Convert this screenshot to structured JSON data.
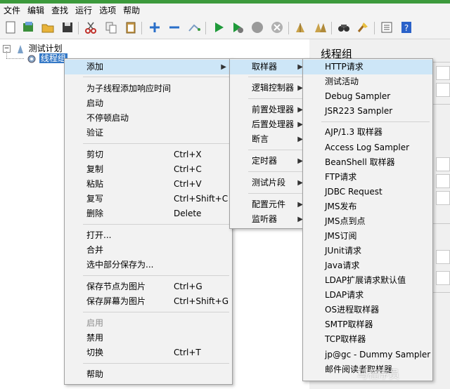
{
  "menubar": {
    "items": [
      "文件",
      "编辑",
      "查找",
      "运行",
      "选项",
      "帮助"
    ]
  },
  "toolbar": {
    "icons": [
      "new-icon",
      "templates-icon",
      "open-icon",
      "save-icon",
      "cut-icon",
      "copy-icon",
      "paste-icon",
      "expand-icon",
      "collapse-icon",
      "toggle-icon",
      "start-icon",
      "start-no-pause-icon",
      "stop-icon",
      "shutdown-icon",
      "clear-icon",
      "clear-all-icon",
      "search-icon",
      "reset-search-icon",
      "function-helper-icon",
      "help-icon"
    ]
  },
  "tree": {
    "root": "测试计划",
    "child": "线程组"
  },
  "right_panel": {
    "title": "线程组"
  },
  "context_menu": {
    "items": [
      {
        "label": "添加",
        "accel": "",
        "submenu": true
      },
      {
        "label": "为子线程添加响应时间",
        "accel": ""
      },
      {
        "label": "启动",
        "accel": ""
      },
      {
        "label": "不停顿启动",
        "accel": ""
      },
      {
        "label": "验证",
        "accel": ""
      },
      {
        "label": "剪切",
        "accel": "Ctrl+X"
      },
      {
        "label": "复制",
        "accel": "Ctrl+C"
      },
      {
        "label": "粘贴",
        "accel": "Ctrl+V"
      },
      {
        "label": "复写",
        "accel": "Ctrl+Shift+C"
      },
      {
        "label": "删除",
        "accel": "Delete"
      },
      {
        "label": "打开...",
        "accel": ""
      },
      {
        "label": "合并",
        "accel": ""
      },
      {
        "label": "选中部分保存为...",
        "accel": ""
      },
      {
        "label": "保存节点为图片",
        "accel": "Ctrl+G"
      },
      {
        "label": "保存屏幕为图片",
        "accel": "Ctrl+Shift+G"
      },
      {
        "label": "启用",
        "accel": "",
        "disabled": true
      },
      {
        "label": "禁用",
        "accel": ""
      },
      {
        "label": "切换",
        "accel": "Ctrl+T"
      },
      {
        "label": "帮助",
        "accel": ""
      }
    ]
  },
  "add_menu": {
    "items": [
      "取样器",
      "逻辑控制器",
      "前置处理器",
      "后置处理器",
      "断言",
      "定时器",
      "测试片段",
      "配置元件",
      "监听器"
    ]
  },
  "sampler_menu": {
    "items": [
      "HTTP请求",
      "测试活动",
      "Debug Sampler",
      "JSR223 Sampler",
      "AJP/1.3 取样器",
      "Access Log Sampler",
      "BeanShell 取样器",
      "FTP请求",
      "JDBC Request",
      "JMS发布",
      "JMS点到点",
      "JMS订阅",
      "JUnit请求",
      "Java请求",
      "LDAP扩展请求默认值",
      "LDAP请求",
      "OS进程取样器",
      "SMTP取样器",
      "TCP取样器",
      "jp@gc - Dummy Sampler",
      "邮件阅读者取样器"
    ]
  },
  "watermark": "马程序员",
  "colors": {
    "accent_strip": "#3c9a3c",
    "selection": "#3478c6",
    "menu_highlight": "#cde6f7"
  }
}
